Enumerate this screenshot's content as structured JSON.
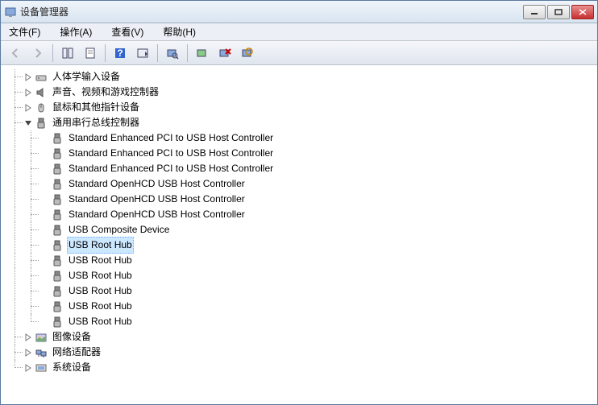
{
  "window": {
    "title": "设备管理器"
  },
  "menu": {
    "file": "文件(F)",
    "action": "操作(A)",
    "view": "查看(V)",
    "help": "帮助(H)"
  },
  "tree": {
    "cat_hid": "人体学输入设备",
    "cat_sound": "声音、视频和游戏控制器",
    "cat_mouse": "鼠标和其他指针设备",
    "cat_usb": "通用串行总线控制器",
    "usb_items": [
      "Standard Enhanced PCI to USB Host Controller",
      "Standard Enhanced PCI to USB Host Controller",
      "Standard Enhanced PCI to USB Host Controller",
      "Standard OpenHCD USB Host Controller",
      "Standard OpenHCD USB Host Controller",
      "Standard OpenHCD USB Host Controller",
      "USB Composite Device",
      "USB Root Hub",
      "USB Root Hub",
      "USB Root Hub",
      "USB Root Hub",
      "USB Root Hub",
      "USB Root Hub"
    ],
    "cat_imaging": "图像设备",
    "cat_network": "网络适配器",
    "cat_system": "系统设备"
  }
}
